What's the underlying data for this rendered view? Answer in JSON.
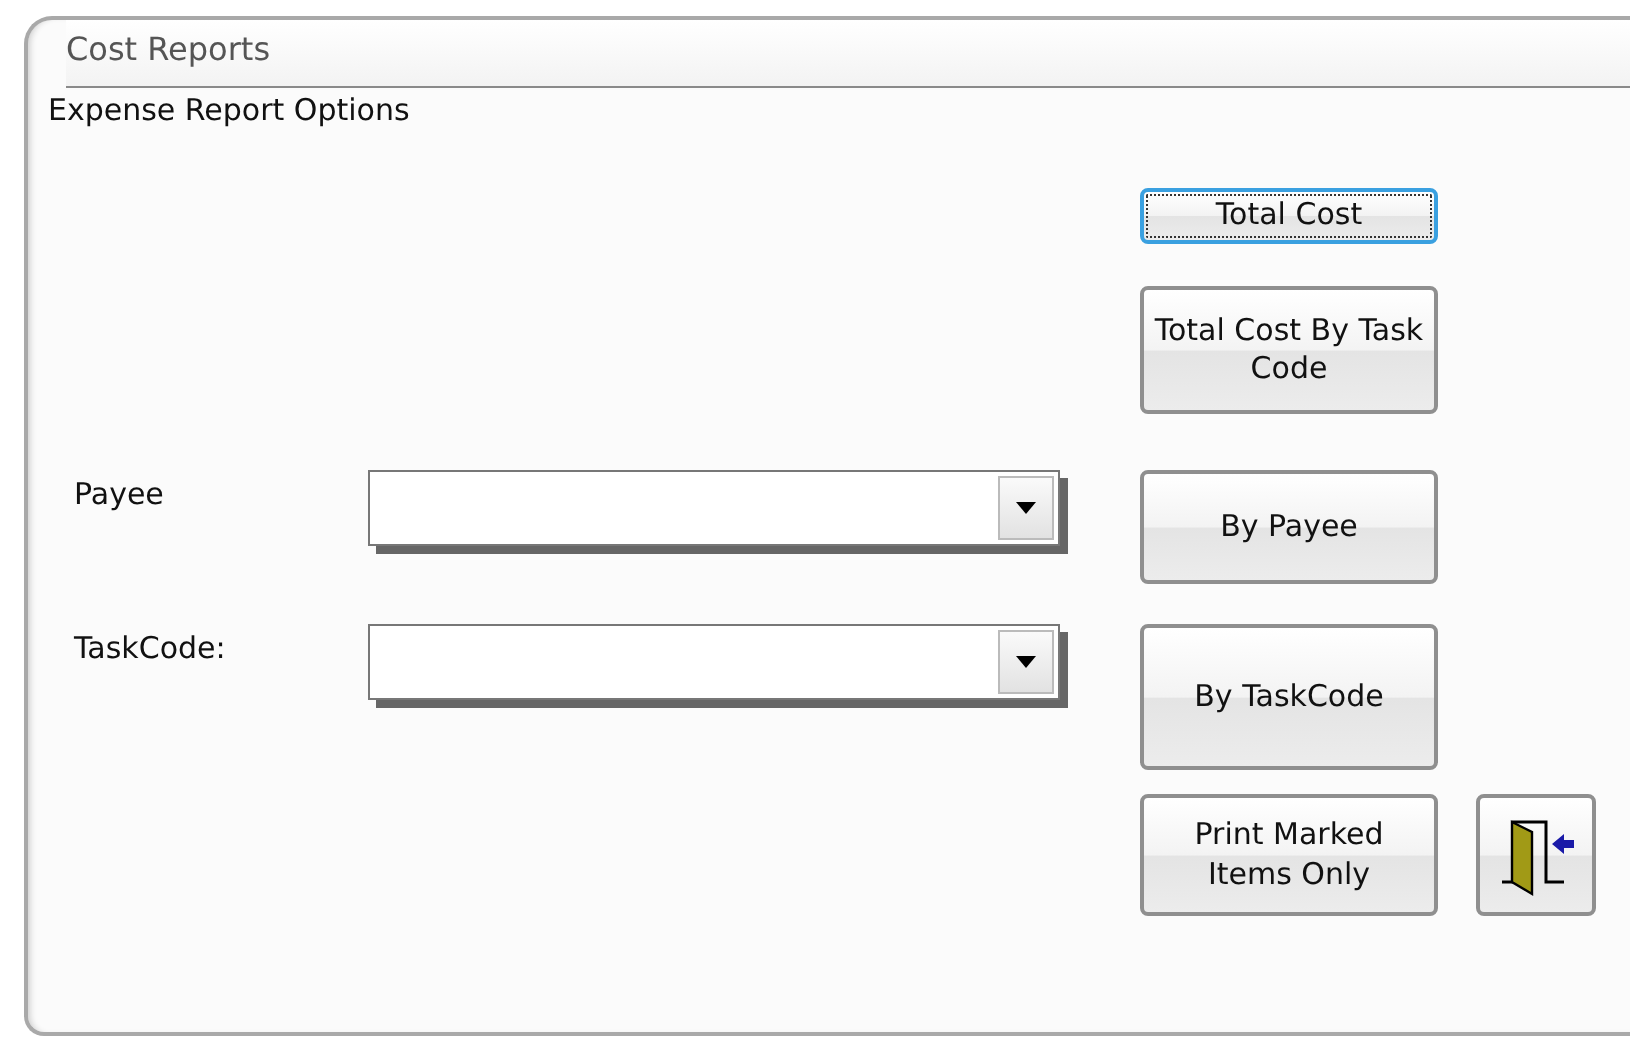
{
  "window": {
    "title": "Cost Reports"
  },
  "subtitle": "Expense Report Options",
  "fields": [
    {
      "label": "Payee"
    },
    {
      "label": "TaskCode:"
    }
  ],
  "buttons": [
    {
      "kind": "text",
      "label": "Total Cost",
      "focused": true
    },
    {
      "kind": "text",
      "label": "Total Cost By Task Code",
      "focused": false
    },
    {
      "kind": "text",
      "label": "By Payee",
      "focused": false
    },
    {
      "kind": "text",
      "label": "By TaskCode",
      "focused": false
    },
    {
      "kind": "text",
      "label": "Print Marked Items Only",
      "focused": false
    },
    {
      "kind": "exit",
      "focused": false
    }
  ]
}
